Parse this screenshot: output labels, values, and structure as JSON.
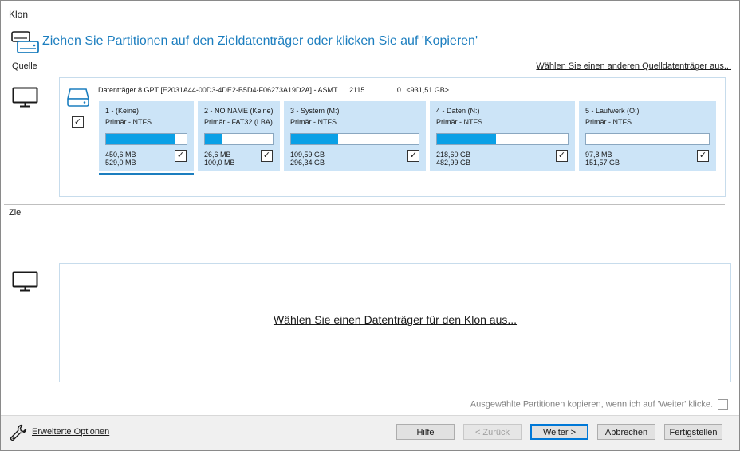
{
  "window": {
    "title": "Klon",
    "headline": "Ziehen Sie Partitionen auf den Zieldatenträger oder klicken Sie auf 'Kopieren'"
  },
  "source": {
    "label": "Quelle",
    "change_link": "Wählen Sie einen anderen Quelldatenträger aus...",
    "disk": {
      "name": "Datenträger 8 GPT [E2031A44-00D3-4DE2-B5D4-F06273A19D2A] - ASMT",
      "model_no": "2115",
      "index": "0",
      "size": "<931,51 GB>",
      "checked": true
    },
    "partitions": [
      {
        "name": "1 -  (Keine)",
        "type": "Primär - NTFS",
        "used": "450,6 MB",
        "total": "529,0 MB",
        "fill_percent": 85,
        "checked": true
      },
      {
        "name": "2 - NO NAME (Keine)",
        "type": "Primär - FAT32 (LBA)",
        "used": "26,6 MB",
        "total": "100,0 MB",
        "fill_percent": 26,
        "checked": true
      },
      {
        "name": "3 - System (M:)",
        "type": "Primär - NTFS",
        "used": "109,59 GB",
        "total": "296,34 GB",
        "fill_percent": 37,
        "checked": true
      },
      {
        "name": "4 - Daten (N:)",
        "type": "Primär - NTFS",
        "used": "218,60 GB",
        "total": "482,99 GB",
        "fill_percent": 45,
        "checked": true
      },
      {
        "name": "5 - Laufwerk (O:)",
        "type": "Primär - NTFS",
        "used": "97,8 MB",
        "total": "151,57 GB",
        "fill_percent": 0,
        "checked": true
      }
    ]
  },
  "target": {
    "label": "Ziel",
    "select_link": "Wählen Sie einen Datenträger für den Klon aus..."
  },
  "copy_option": {
    "label": "Ausgewählte Partitionen kopieren, wenn ich auf 'Weiter' klicke.",
    "checked": false
  },
  "footer": {
    "advanced_options": "Erweiterte Optionen",
    "buttons": {
      "help": "Hilfe",
      "back": "< Zurück",
      "next": "Weiter >",
      "cancel": "Abbrechen",
      "finish": "Fertigstellen"
    }
  },
  "colors": {
    "accent": "#1c7ebf",
    "partition_bg": "#cce4f7",
    "bar_fill": "#0aa0e6"
  }
}
